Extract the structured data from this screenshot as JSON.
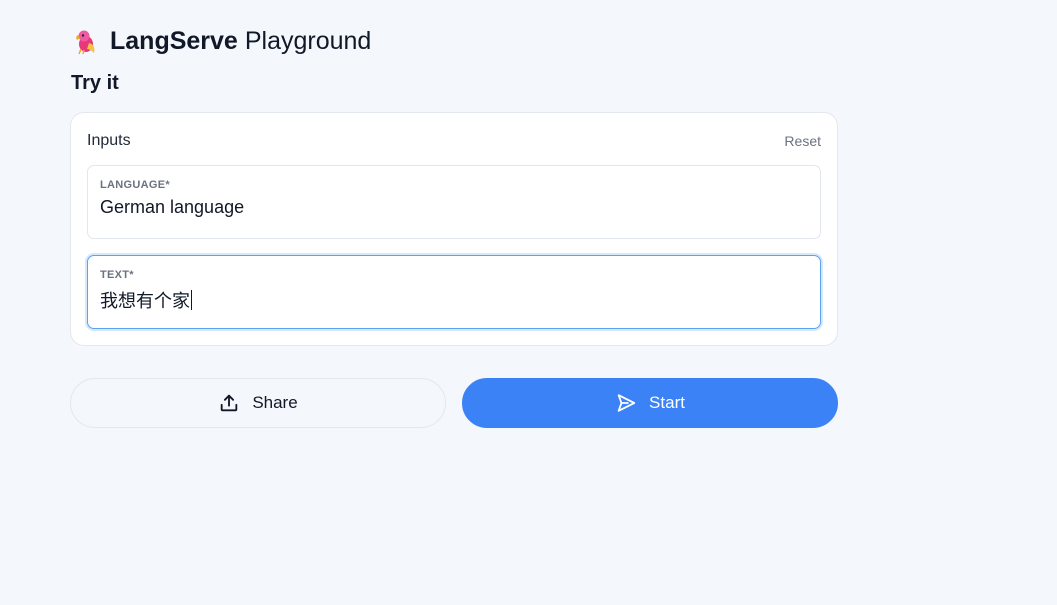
{
  "header": {
    "brand": "LangServe",
    "subtitle": "Playground",
    "logo_icon": "parrot-icon"
  },
  "section": {
    "title": "Try it"
  },
  "inputs_card": {
    "label": "Inputs",
    "reset_label": "Reset",
    "fields": [
      {
        "label": "LANGUAGE*",
        "value": "German language"
      },
      {
        "label": "TEXT*",
        "value": "我想有个家"
      }
    ]
  },
  "actions": {
    "share_label": "Share",
    "share_icon": "share-upload-icon",
    "start_label": "Start",
    "start_icon": "send-icon"
  },
  "colors": {
    "accent": "#3b82f6",
    "background": "#f4f7fb",
    "focus_border": "#5aa2f2"
  }
}
